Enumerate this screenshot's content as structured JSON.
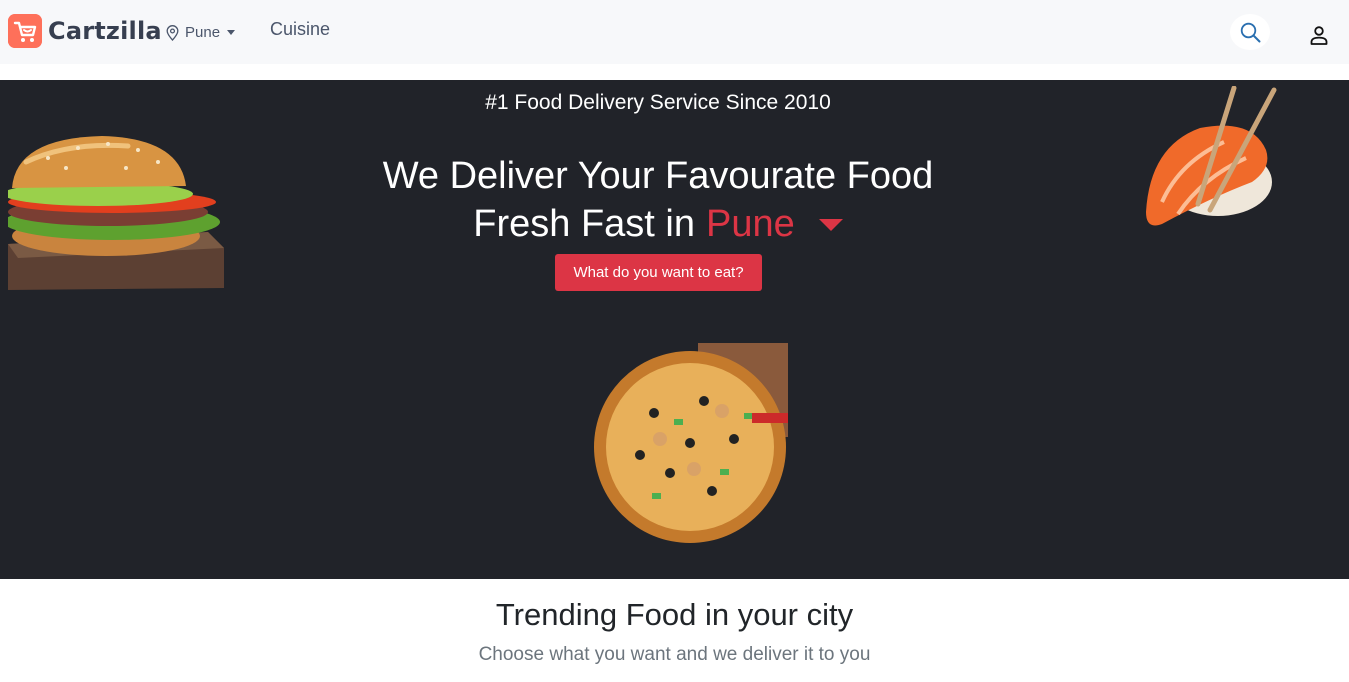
{
  "header": {
    "brand_name": "Cartzilla",
    "city": "Pune",
    "nav_cuisine": "Cuisine",
    "icons": {
      "logo": "cart-logo-icon",
      "location": "map-pin-icon",
      "search": "search-icon",
      "account": "user-icon"
    }
  },
  "hero": {
    "tagline": "#1 Food Delivery Service Since 2010",
    "title_line1": "We Deliver Your Favourate Food",
    "title_line2_prefix": "Fresh Fast in",
    "city": "Pune",
    "cta_label": "What do you want to eat?",
    "images": [
      "burger",
      "sushi",
      "pizza"
    ]
  },
  "trending": {
    "title": "Trending Food in your city",
    "subtitle": "Choose what you want and we deliver it to you"
  },
  "colors": {
    "brand": "#fe705a",
    "accent": "#dc3545",
    "hero_bg": "#212329",
    "header_bg": "#f7f8fa"
  }
}
